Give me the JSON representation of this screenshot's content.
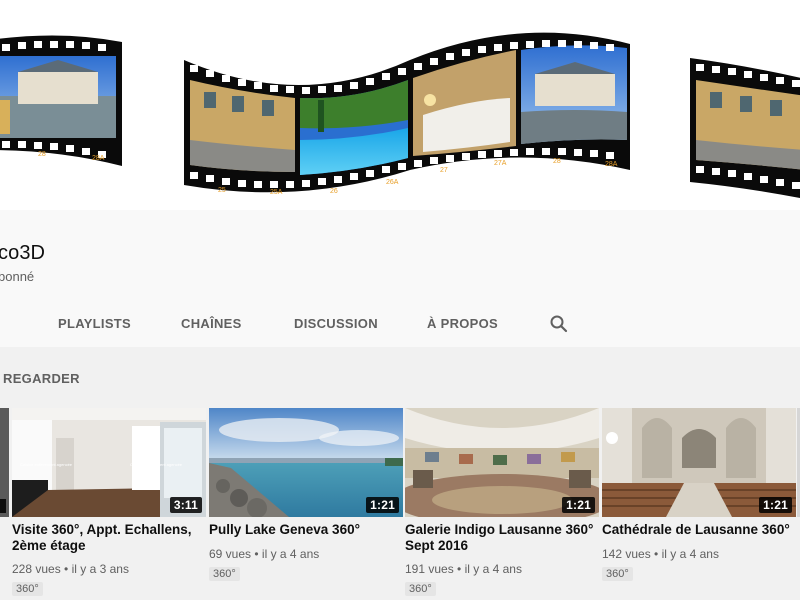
{
  "channel": {
    "name": "co3D",
    "subscribers": "bonné"
  },
  "tabs": [
    {
      "label": "PLAYLISTS"
    },
    {
      "label": "CHAÎNES"
    },
    {
      "label": "DISCUSSION"
    },
    {
      "label": "À PROPOS"
    }
  ],
  "search_icon": "search-icon",
  "section": {
    "title": "REGARDER"
  },
  "banner": {
    "film_labels": [
      "28",
      "28A",
      "25",
      "25A",
      "26",
      "26A",
      "27",
      "27A",
      "28",
      "28A"
    ]
  },
  "videos": [
    {
      "title": "Visite 360°, Appt. Echallens, 2ème étage",
      "views": "228 vues",
      "age": "il y a 3 ans",
      "duration": "3:11",
      "badge": "360°"
    },
    {
      "title": "Pully Lake Geneva 360°",
      "views": "69 vues",
      "age": "il y a 4 ans",
      "duration": "1:21",
      "badge": "360°"
    },
    {
      "title": "Galerie Indigo Lausanne 360° Sept 2016",
      "views": "191 vues",
      "age": "il y a 4 ans",
      "duration": "1:21",
      "badge": "360°"
    },
    {
      "title": "Cathédrale de Lausanne 360°",
      "views": "142 vues",
      "age": "il y a 4 ans",
      "duration": "1:21",
      "badge": "360°"
    }
  ],
  "colors": {
    "page_bg": "#f9f9f9",
    "content_bg": "#f1f1f1",
    "text_primary": "#0f0f0f",
    "text_secondary": "#606060",
    "film": "#0a0a0a",
    "film_label": "#e8a02a"
  }
}
